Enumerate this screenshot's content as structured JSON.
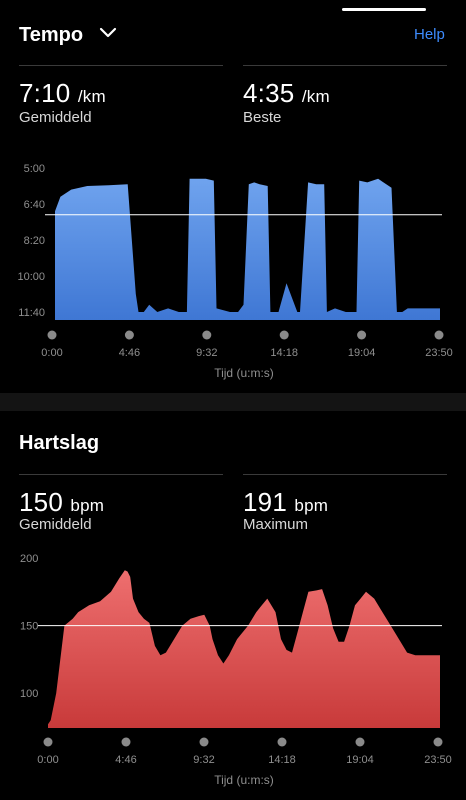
{
  "pace": {
    "title": "Tempo",
    "help": "Help",
    "average": {
      "value": "7:10",
      "unit": "/km",
      "label": "Gemiddeld"
    },
    "best": {
      "value": "4:35",
      "unit": "/km",
      "label": "Beste"
    },
    "axis_title": "Tijd (u:m:s)"
  },
  "heart": {
    "title": "Hartslag",
    "average": {
      "value": "150",
      "unit": "bpm",
      "label": "Gemiddeld"
    },
    "max": {
      "value": "191",
      "unit": "bpm",
      "label": "Maximum"
    },
    "axis_title": "Tijd (u:m:s)"
  },
  "colors": {
    "pace_fill": "#5b93e6",
    "heart_fill": "#e25d5d",
    "accent": "#3d8bfd"
  },
  "chart_data": [
    {
      "type": "area",
      "y_ticks": [
        "5:00",
        "6:40",
        "8:20",
        "10:00",
        "11:40"
      ],
      "y_inverted": true,
      "ylim_sec_per_km": [
        300,
        700
      ],
      "x_ticks": [
        "0:00",
        "4:46",
        "9:32",
        "14:18",
        "19:04",
        "23:50"
      ],
      "xlim_sec": [
        0,
        1430
      ],
      "xlabel": "Tijd (u:m:s)",
      "average_line_sec_per_km": 430,
      "series": [
        {
          "x": [
            0,
            20,
            60,
            120,
            200,
            270,
            300,
            310,
            330,
            350,
            380,
            420,
            460,
            490,
            500,
            530,
            560,
            590,
            600,
            650,
            680,
            700,
            720,
            740,
            760,
            790,
            800,
            830,
            860,
            900,
            910,
            940,
            970,
            1000,
            1010,
            1040,
            1080,
            1120,
            1130,
            1160,
            1200,
            1250,
            1270,
            1290,
            1310,
            1330,
            1380,
            1430
          ],
          "y": [
            420,
            380,
            360,
            350,
            348,
            345,
            650,
            700,
            700,
            680,
            700,
            690,
            700,
            700,
            330,
            330,
            330,
            335,
            690,
            700,
            700,
            680,
            345,
            340,
            345,
            350,
            700,
            700,
            620,
            700,
            700,
            340,
            345,
            345,
            700,
            690,
            700,
            700,
            335,
            340,
            330,
            355,
            700,
            700,
            690,
            690,
            690,
            690
          ]
        }
      ]
    },
    {
      "type": "area",
      "y_ticks": [
        "200",
        "150",
        "100"
      ],
      "ylim": [
        75,
        200
      ],
      "x_ticks": [
        "0:00",
        "4:46",
        "9:32",
        "14:18",
        "19:04",
        "23:50"
      ],
      "xlim_sec": [
        0,
        1430
      ],
      "xlabel": "Tijd (u:m:s)",
      "average_line": 150,
      "series": [
        {
          "x": [
            0,
            10,
            30,
            60,
            90,
            110,
            150,
            190,
            230,
            260,
            280,
            290,
            300,
            310,
            330,
            350,
            370,
            390,
            410,
            430,
            460,
            490,
            520,
            550,
            570,
            590,
            600,
            620,
            640,
            660,
            690,
            730,
            760,
            780,
            800,
            830,
            850,
            870,
            890,
            910,
            930,
            950,
            980,
            1000,
            1020,
            1040,
            1060,
            1080,
            1100,
            1120,
            1140,
            1160,
            1190,
            1220,
            1250,
            1280,
            1310,
            1340,
            1370,
            1400,
            1430
          ],
          "y": [
            77,
            80,
            100,
            150,
            155,
            160,
            165,
            168,
            175,
            185,
            191,
            190,
            186,
            170,
            160,
            155,
            152,
            135,
            128,
            130,
            140,
            150,
            155,
            157,
            158,
            150,
            140,
            128,
            122,
            128,
            140,
            150,
            160,
            165,
            170,
            160,
            140,
            132,
            130,
            145,
            160,
            175,
            176,
            177,
            165,
            148,
            138,
            138,
            150,
            165,
            170,
            175,
            170,
            160,
            150,
            140,
            130,
            128,
            128,
            128,
            128
          ]
        }
      ]
    }
  ]
}
